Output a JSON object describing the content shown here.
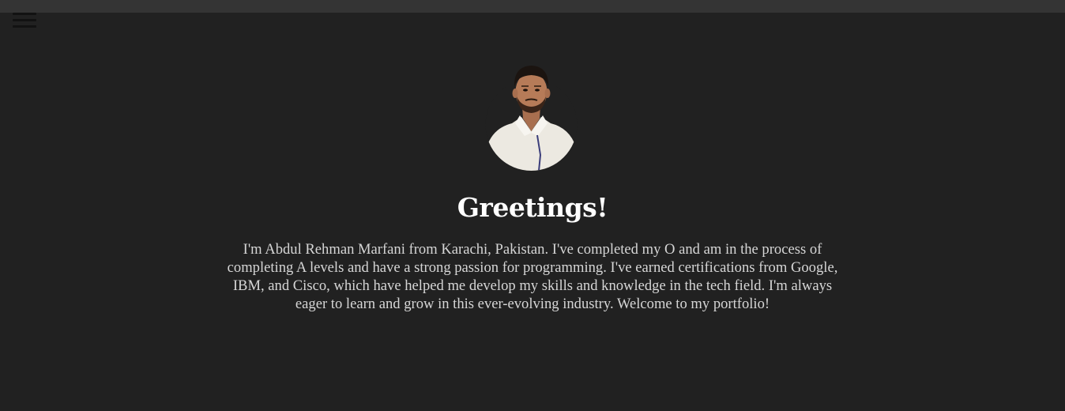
{
  "header": {
    "menu_icon": "hamburger-menu-icon"
  },
  "profile": {
    "photo_alt": "Abdul Rehman Marfani",
    "title": "Greetings!",
    "intro": "I'm Abdul Rehman Marfani from Karachi, Pakistan. I've completed my O and am in the process of completing A levels and have a strong passion for programming. I've earned certifications from Google, IBM, and Cisco, which have helped me develop my skills and knowledge in the tech field. I'm always eager to learn and grow in this ever-evolving industry. Welcome to my portfolio!"
  },
  "colors": {
    "background": "#212121",
    "top_bar": "#343434",
    "title_text": "#ffffff",
    "body_text": "#d6d6d6"
  }
}
